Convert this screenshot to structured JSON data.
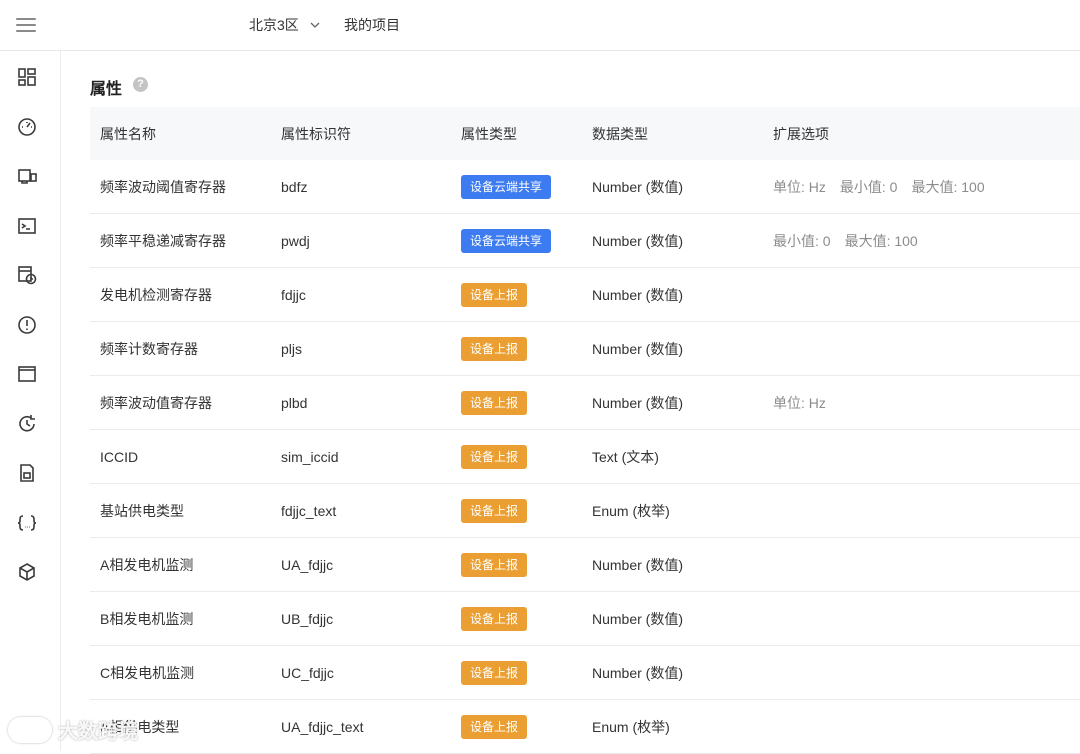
{
  "header": {
    "region": "北京3区",
    "project": "我的项目"
  },
  "section": {
    "title": "属性",
    "help": "?"
  },
  "table": {
    "columns": [
      "属性名称",
      "属性标识符",
      "属性类型",
      "数据类型",
      "扩展选项"
    ],
    "rows": [
      {
        "name": "频率波动阈值寄存器",
        "id": "bdfz",
        "type": "设备云端共享",
        "type_kind": "cloud",
        "dtype": "Number (数值)",
        "ext": [
          "单位: Hz",
          "最小值: 0",
          "最大值: 100"
        ]
      },
      {
        "name": "频率平稳递减寄存器",
        "id": "pwdj",
        "type": "设备云端共享",
        "type_kind": "cloud",
        "dtype": "Number (数值)",
        "ext": [
          "最小值: 0",
          "最大值: 100"
        ]
      },
      {
        "name": "发电机检测寄存器",
        "id": "fdjjc",
        "type": "设备上报",
        "type_kind": "report",
        "dtype": "Number (数值)",
        "ext": []
      },
      {
        "name": "频率计数寄存器",
        "id": "pljs",
        "type": "设备上报",
        "type_kind": "report",
        "dtype": "Number (数值)",
        "ext": []
      },
      {
        "name": "频率波动值寄存器",
        "id": "plbd",
        "type": "设备上报",
        "type_kind": "report",
        "dtype": "Number (数值)",
        "ext": [
          "单位: Hz"
        ]
      },
      {
        "name": "ICCID",
        "id": "sim_iccid",
        "type": "设备上报",
        "type_kind": "report",
        "dtype": "Text (文本)",
        "ext": []
      },
      {
        "name": "基站供电类型",
        "id": "fdjjc_text",
        "type": "设备上报",
        "type_kind": "report",
        "dtype": "Enum (枚举)",
        "ext": []
      },
      {
        "name": "A相发电机监测",
        "id": "UA_fdjjc",
        "type": "设备上报",
        "type_kind": "report",
        "dtype": "Number (数值)",
        "ext": []
      },
      {
        "name": "B相发电机监测",
        "id": "UB_fdjjc",
        "type": "设备上报",
        "type_kind": "report",
        "dtype": "Number (数值)",
        "ext": []
      },
      {
        "name": "C相发电机监测",
        "id": "UC_fdjjc",
        "type": "设备上报",
        "type_kind": "report",
        "dtype": "Number (数值)",
        "ext": []
      },
      {
        "name": "A相供电类型",
        "id": "UA_fdjjc_text",
        "type": "设备上报",
        "type_kind": "report",
        "dtype": "Enum (枚举)",
        "ext": []
      }
    ]
  },
  "sidebar": {
    "icons": [
      "dashboard-icon",
      "gauge-icon",
      "devices-icon",
      "terminal-icon",
      "schedule-icon",
      "alert-icon",
      "window-icon",
      "history-icon",
      "sim-card-icon",
      "code-braces-icon",
      "package-icon"
    ]
  },
  "colors": {
    "cloud_tag": "#3c7bf0",
    "report_tag": "#eb9f32",
    "header_bg": "#f7f8fa"
  },
  "watermark": "大数跨境"
}
